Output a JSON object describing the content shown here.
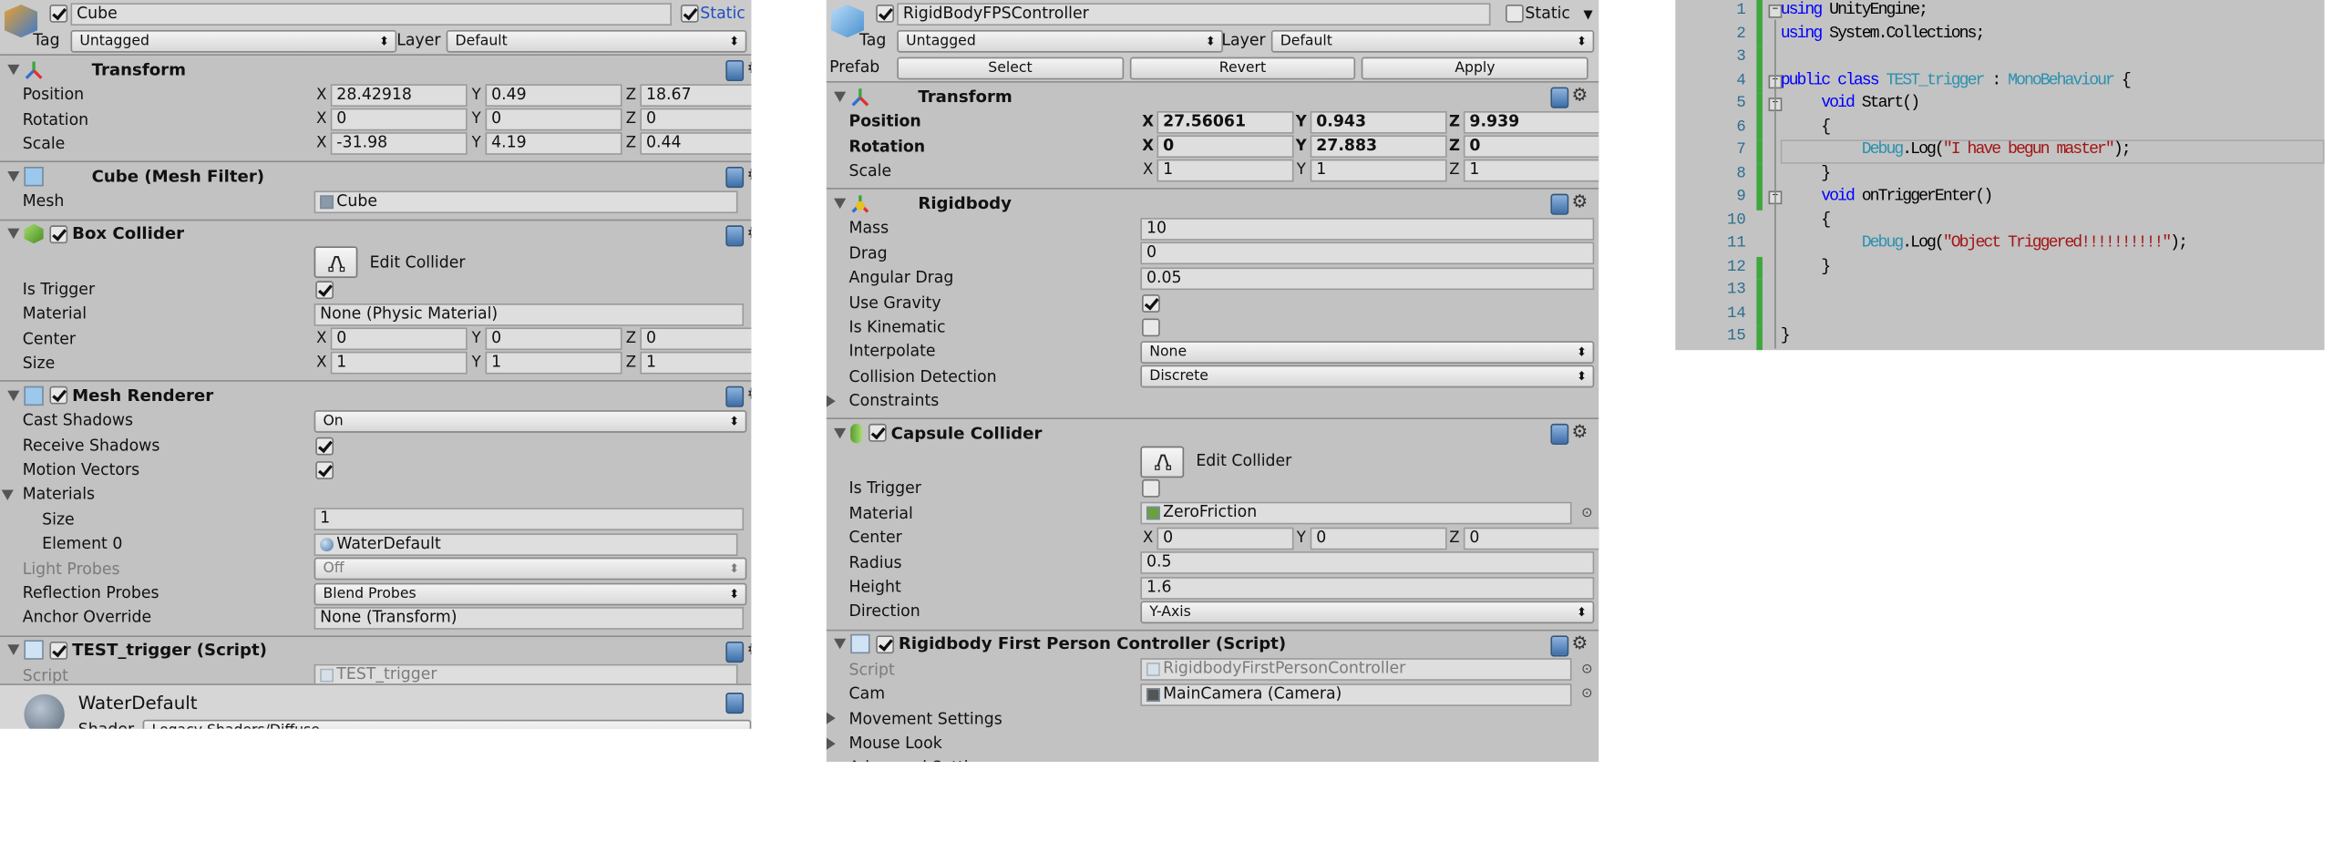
{
  "left_inspector": {
    "object": {
      "active": true,
      "name": "Cube",
      "static_label": "Static",
      "static": true,
      "tag_label": "Tag",
      "tag": "Untagged",
      "layer_label": "Layer",
      "layer": "Default"
    },
    "components": [
      {
        "title": "Transform",
        "icon": "transform-icon",
        "checkbox": null,
        "rows": [
          {
            "type": "vec",
            "label": "Position",
            "x": "28.42918",
            "y": "0.49",
            "z": "18.67"
          },
          {
            "type": "vec",
            "label": "Rotation",
            "x": "0",
            "y": "0",
            "z": "0"
          },
          {
            "type": "vec",
            "label": "Scale",
            "x": "-31.98",
            "y": "4.19",
            "z": "0.44"
          }
        ]
      },
      {
        "title": "Cube (Mesh Filter)",
        "icon": "mesh-filter-icon",
        "checkbox": null,
        "rows": [
          {
            "type": "object",
            "label": "Mesh",
            "value": "Cube",
            "icon": "mesh-icon"
          }
        ]
      },
      {
        "title": "Box Collider",
        "icon": "box-collider-icon",
        "checkbox": true,
        "rows": [
          {
            "type": "edit",
            "label": "Edit Collider"
          },
          {
            "type": "check",
            "label": "Is Trigger",
            "checked": true
          },
          {
            "type": "field",
            "label": "Material",
            "value": "None (Physic Material)"
          },
          {
            "type": "vec",
            "label": "Center",
            "x": "0",
            "y": "0",
            "z": "0"
          },
          {
            "type": "vec",
            "label": "Size",
            "x": "1",
            "y": "1",
            "z": "1"
          }
        ]
      },
      {
        "title": "Mesh Renderer",
        "icon": "mesh-renderer-icon",
        "checkbox": true,
        "rows": [
          {
            "type": "drop",
            "label": "Cast Shadows",
            "value": "On"
          },
          {
            "type": "check",
            "label": "Receive Shadows",
            "checked": true
          },
          {
            "type": "check",
            "label": "Motion Vectors",
            "checked": true
          },
          {
            "type": "fold",
            "label": "Materials",
            "open": true
          },
          {
            "type": "field",
            "label": "Size",
            "value": "1",
            "indent": true
          },
          {
            "type": "object",
            "label": "Element 0",
            "value": "WaterDefault",
            "icon": "material-sphere-icon",
            "indent": true
          },
          {
            "type": "drop",
            "label": "Light Probes",
            "value": "Off",
            "disabled": true
          },
          {
            "type": "drop",
            "label": "Reflection Probes",
            "value": "Blend Probes"
          },
          {
            "type": "field",
            "label": "Anchor Override",
            "value": "None (Transform)"
          }
        ]
      },
      {
        "title": "TEST_trigger (Script)",
        "icon": "script-icon",
        "checkbox": true,
        "rows": [
          {
            "type": "object",
            "label": "Script",
            "value": "TEST_trigger",
            "icon": "script-icon",
            "disabled": true
          }
        ]
      }
    ],
    "material": {
      "name": "WaterDefault",
      "shader_label": "Shader",
      "shader": "Legacy Shaders/Diffuse"
    }
  },
  "mid_inspector": {
    "object": {
      "active": true,
      "name": "RigidBodyFPSController",
      "static_label": "Static",
      "static": false,
      "tag_label": "Tag",
      "tag": "Untagged",
      "layer_label": "Layer",
      "layer": "Default",
      "prefab_label": "Prefab",
      "prefab_buttons": [
        "Select",
        "Revert",
        "Apply"
      ]
    },
    "components": [
      {
        "title": "Transform",
        "icon": "transform-icon",
        "checkbox": null,
        "rows": [
          {
            "type": "vec",
            "label": "Position",
            "x": "27.56061",
            "y": "0.943",
            "z": "9.939",
            "bold": true
          },
          {
            "type": "vec",
            "label": "Rotation",
            "x": "0",
            "y": "27.883",
            "z": "0",
            "bold": true
          },
          {
            "type": "vec",
            "label": "Scale",
            "x": "1",
            "y": "1",
            "z": "1"
          }
        ]
      },
      {
        "title": "Rigidbody",
        "icon": "rigidbody-icon",
        "checkbox": null,
        "rows": [
          {
            "type": "field",
            "label": "Mass",
            "value": "10"
          },
          {
            "type": "field",
            "label": "Drag",
            "value": "0"
          },
          {
            "type": "field",
            "label": "Angular Drag",
            "value": "0.05"
          },
          {
            "type": "check",
            "label": "Use Gravity",
            "checked": true
          },
          {
            "type": "check",
            "label": "Is Kinematic",
            "checked": false
          },
          {
            "type": "drop",
            "label": "Interpolate",
            "value": "None"
          },
          {
            "type": "drop",
            "label": "Collision Detection",
            "value": "Discrete"
          },
          {
            "type": "fold",
            "label": "Constraints",
            "open": false
          }
        ]
      },
      {
        "title": "Capsule Collider",
        "icon": "capsule-collider-icon",
        "checkbox": true,
        "rows": [
          {
            "type": "edit",
            "label": "Edit Collider"
          },
          {
            "type": "check",
            "label": "Is Trigger",
            "checked": false
          },
          {
            "type": "object",
            "label": "Material",
            "value": "ZeroFriction",
            "icon": "physic-material-icon",
            "picker": true
          },
          {
            "type": "vec",
            "label": "Center",
            "x": "0",
            "y": "0",
            "z": "0"
          },
          {
            "type": "field",
            "label": "Radius",
            "value": "0.5"
          },
          {
            "type": "field",
            "label": "Height",
            "value": "1.6"
          },
          {
            "type": "drop",
            "label": "Direction",
            "value": "Y-Axis"
          }
        ]
      },
      {
        "title": "Rigidbody First Person Controller (Script)",
        "icon": "script-icon",
        "checkbox": true,
        "rows": [
          {
            "type": "object",
            "label": "Script",
            "value": "RigidbodyFirstPersonController",
            "icon": "script-icon",
            "disabled": true,
            "picker": true
          },
          {
            "type": "object",
            "label": "Cam",
            "value": "MainCamera (Camera)",
            "icon": "camera-icon",
            "picker": true
          },
          {
            "type": "fold",
            "label": "Movement Settings",
            "open": false
          },
          {
            "type": "fold",
            "label": "Mouse Look",
            "open": false
          },
          {
            "type": "fold",
            "label": "Advanced Settings",
            "open": false
          }
        ]
      }
    ]
  },
  "code_editor": {
    "lines": [
      {
        "n": "1",
        "tokens": [
          [
            "kw",
            "using"
          ],
          [
            "",
            "UnityEngine;"
          ]
        ],
        "fold": "minus",
        "changed": true,
        "indent": 0
      },
      {
        "n": "2",
        "tokens": [
          [
            "kw",
            "using"
          ],
          [
            "",
            "System.Collections;"
          ]
        ],
        "changed": true,
        "indent": 0
      },
      {
        "n": "3",
        "tokens": [],
        "changed": true,
        "indent": 0
      },
      {
        "n": "4",
        "tokens": [
          [
            "kw",
            "public"
          ],
          [
            "kw",
            "class"
          ],
          [
            "ty",
            "TEST_trigger"
          ],
          [
            "",
            ":"
          ],
          [
            "ty",
            "MonoBehaviour"
          ],
          [
            "",
            "{"
          ]
        ],
        "fold": "minus",
        "changed": true,
        "indent": 0
      },
      {
        "n": "5",
        "tokens": [
          [
            "kw",
            "void"
          ],
          [
            "",
            "Start()"
          ]
        ],
        "fold": "minus",
        "changed": true,
        "indent": 1
      },
      {
        "n": "6",
        "tokens": [
          [
            "",
            "{"
          ]
        ],
        "changed": true,
        "indent": 1
      },
      {
        "n": "7",
        "tokens": [
          [
            "ty",
            "Debug"
          ],
          [
            "",
            ".Log("
          ],
          [
            "st",
            "\"I have begun master\""
          ],
          [
            "",
            ");"
          ]
        ],
        "changed": true,
        "indent": 2,
        "current": true
      },
      {
        "n": "8",
        "tokens": [
          [
            "",
            "}"
          ]
        ],
        "changed": true,
        "indent": 1
      },
      {
        "n": "9",
        "tokens": [
          [
            "kw",
            "void"
          ],
          [
            "",
            "onTriggerEnter()"
          ]
        ],
        "fold": "minus",
        "changed": true,
        "indent": 1
      },
      {
        "n": "10",
        "tokens": [
          [
            "",
            "{"
          ]
        ],
        "changed": false,
        "indent": 1
      },
      {
        "n": "11",
        "tokens": [
          [
            "ty",
            "Debug"
          ],
          [
            "",
            ".Log("
          ],
          [
            "st",
            "\"Object Triggered!!!!!!!!!!\""
          ],
          [
            "",
            ");"
          ]
        ],
        "changed": false,
        "indent": 2
      },
      {
        "n": "12",
        "tokens": [
          [
            "",
            "}"
          ]
        ],
        "changed": true,
        "indent": 1
      },
      {
        "n": "13",
        "tokens": [],
        "changed": true,
        "indent": 0
      },
      {
        "n": "14",
        "tokens": [],
        "changed": true,
        "indent": 0
      },
      {
        "n": "15",
        "tokens": [
          [
            "",
            "}"
          ]
        ],
        "changed": true,
        "indent": 0
      }
    ],
    "colors": {
      "keyword": "#0000ff",
      "type": "#2b91af",
      "string": "#a31515",
      "changed_bar": "#3ea83e"
    }
  }
}
